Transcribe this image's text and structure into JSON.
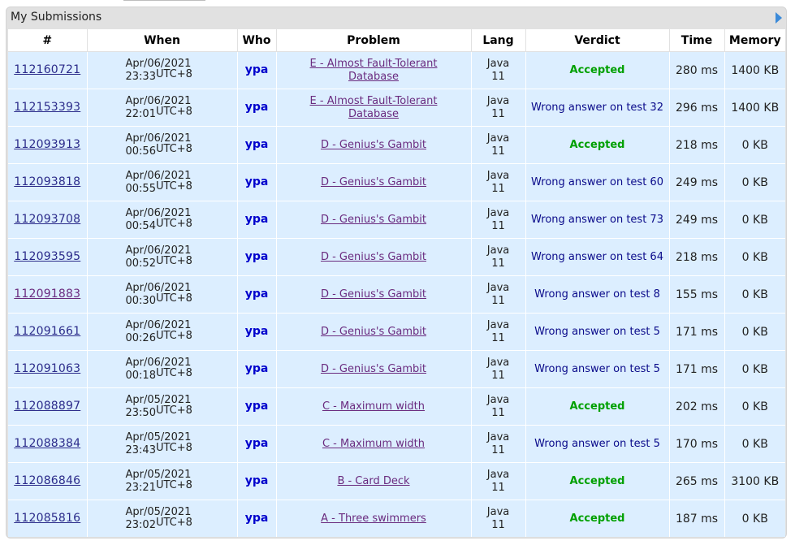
{
  "panel": {
    "title": "My Submissions",
    "expand_icon": "triangle-right-icon"
  },
  "table": {
    "headers": {
      "id": "#",
      "when": "When",
      "who": "Who",
      "problem": "Problem",
      "lang": "Lang",
      "verdict": "Verdict",
      "time": "Time",
      "memory": "Memory"
    },
    "rows": [
      {
        "id": "112160721",
        "date": "Apr/06/2021",
        "time": "23:33",
        "tz": "UTC+8",
        "who": "ypa",
        "problem": "E - Almost Fault-Tolerant Database",
        "lang": "Java 11",
        "verdict": "Accepted",
        "accepted": true,
        "exec_time": "280 ms",
        "memory": "1400 KB"
      },
      {
        "id": "112153393",
        "date": "Apr/06/2021",
        "time": "22:01",
        "tz": "UTC+8",
        "who": "ypa",
        "problem": "E - Almost Fault-Tolerant Database",
        "lang": "Java 11",
        "verdict": "Wrong answer on test 32",
        "accepted": false,
        "exec_time": "296 ms",
        "memory": "1400 KB"
      },
      {
        "id": "112093913",
        "date": "Apr/06/2021",
        "time": "00:56",
        "tz": "UTC+8",
        "who": "ypa",
        "problem": "D - Genius's Gambit",
        "lang": "Java 11",
        "verdict": "Accepted",
        "accepted": true,
        "exec_time": "218 ms",
        "memory": "0 KB"
      },
      {
        "id": "112093818",
        "date": "Apr/06/2021",
        "time": "00:55",
        "tz": "UTC+8",
        "who": "ypa",
        "problem": "D - Genius's Gambit",
        "lang": "Java 11",
        "verdict": "Wrong answer on test 60",
        "accepted": false,
        "exec_time": "249 ms",
        "memory": "0 KB"
      },
      {
        "id": "112093708",
        "date": "Apr/06/2021",
        "time": "00:54",
        "tz": "UTC+8",
        "who": "ypa",
        "problem": "D - Genius's Gambit",
        "lang": "Java 11",
        "verdict": "Wrong answer on test 73",
        "accepted": false,
        "exec_time": "249 ms",
        "memory": "0 KB"
      },
      {
        "id": "112093595",
        "date": "Apr/06/2021",
        "time": "00:52",
        "tz": "UTC+8",
        "who": "ypa",
        "problem": "D - Genius's Gambit",
        "lang": "Java 11",
        "verdict": "Wrong answer on test 64",
        "accepted": false,
        "exec_time": "218 ms",
        "memory": "0 KB"
      },
      {
        "id": "112091883",
        "date": "Apr/06/2021",
        "time": "00:30",
        "tz": "UTC+8",
        "who": "ypa",
        "problem": "D - Genius's Gambit",
        "lang": "Java 11",
        "verdict": "Wrong answer on test 8",
        "accepted": false,
        "exec_time": "155 ms",
        "memory": "0 KB",
        "visited": true
      },
      {
        "id": "112091661",
        "date": "Apr/06/2021",
        "time": "00:26",
        "tz": "UTC+8",
        "who": "ypa",
        "problem": "D - Genius's Gambit",
        "lang": "Java 11",
        "verdict": "Wrong answer on test 5",
        "accepted": false,
        "exec_time": "171 ms",
        "memory": "0 KB"
      },
      {
        "id": "112091063",
        "date": "Apr/06/2021",
        "time": "00:18",
        "tz": "UTC+8",
        "who": "ypa",
        "problem": "D - Genius's Gambit",
        "lang": "Java 11",
        "verdict": "Wrong answer on test 5",
        "accepted": false,
        "exec_time": "171 ms",
        "memory": "0 KB"
      },
      {
        "id": "112088897",
        "date": "Apr/05/2021",
        "time": "23:50",
        "tz": "UTC+8",
        "who": "ypa",
        "problem": "C - Maximum width",
        "lang": "Java 11",
        "verdict": "Accepted",
        "accepted": true,
        "exec_time": "202 ms",
        "memory": "0 KB"
      },
      {
        "id": "112088384",
        "date": "Apr/05/2021",
        "time": "23:43",
        "tz": "UTC+8",
        "who": "ypa",
        "problem": "C - Maximum width",
        "lang": "Java 11",
        "verdict": "Wrong answer on test 5",
        "accepted": false,
        "exec_time": "170 ms",
        "memory": "0 KB"
      },
      {
        "id": "112086846",
        "date": "Apr/05/2021",
        "time": "23:21",
        "tz": "UTC+8",
        "who": "ypa",
        "problem": "B - Card Deck",
        "lang": "Java 11",
        "verdict": "Accepted",
        "accepted": true,
        "exec_time": "265 ms",
        "memory": "3100 KB"
      },
      {
        "id": "112085816",
        "date": "Apr/05/2021",
        "time": "23:02",
        "tz": "UTC+8",
        "who": "ypa",
        "problem": "A - Three swimmers",
        "lang": "Java 11",
        "verdict": "Accepted",
        "accepted": true,
        "exec_time": "187 ms",
        "memory": "0 KB"
      }
    ]
  }
}
